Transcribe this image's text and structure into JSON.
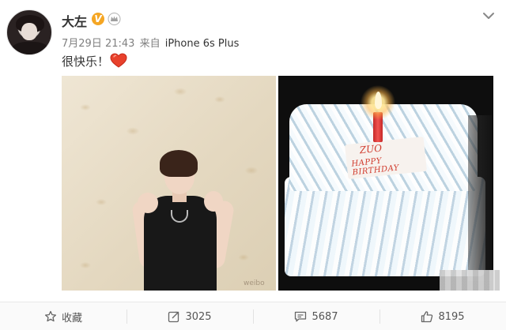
{
  "post": {
    "username": "大左",
    "verified_badge": "V",
    "date": "7月29日 21:43",
    "source_prefix": "来自",
    "source": "iPhone 6s Plus",
    "text": "很快乐！",
    "photos": [
      {
        "watermark": "weibo"
      },
      {
        "plaque_line1": "ZUO",
        "plaque_line2": "HAPPY BIRTHDAY"
      }
    ]
  },
  "toolbar": {
    "favorite_label": "收藏",
    "repost_count": "3025",
    "comment_count": "5687",
    "like_count": "8195"
  },
  "colors": {
    "verified": "#f5a623",
    "heart": "#e8412c",
    "text_primary": "#333333",
    "text_meta": "#808080"
  },
  "icons": [
    "crown-icon",
    "chevron-down-icon",
    "heart-emoji-icon",
    "star-icon",
    "repost-icon",
    "comment-icon",
    "like-icon"
  ]
}
